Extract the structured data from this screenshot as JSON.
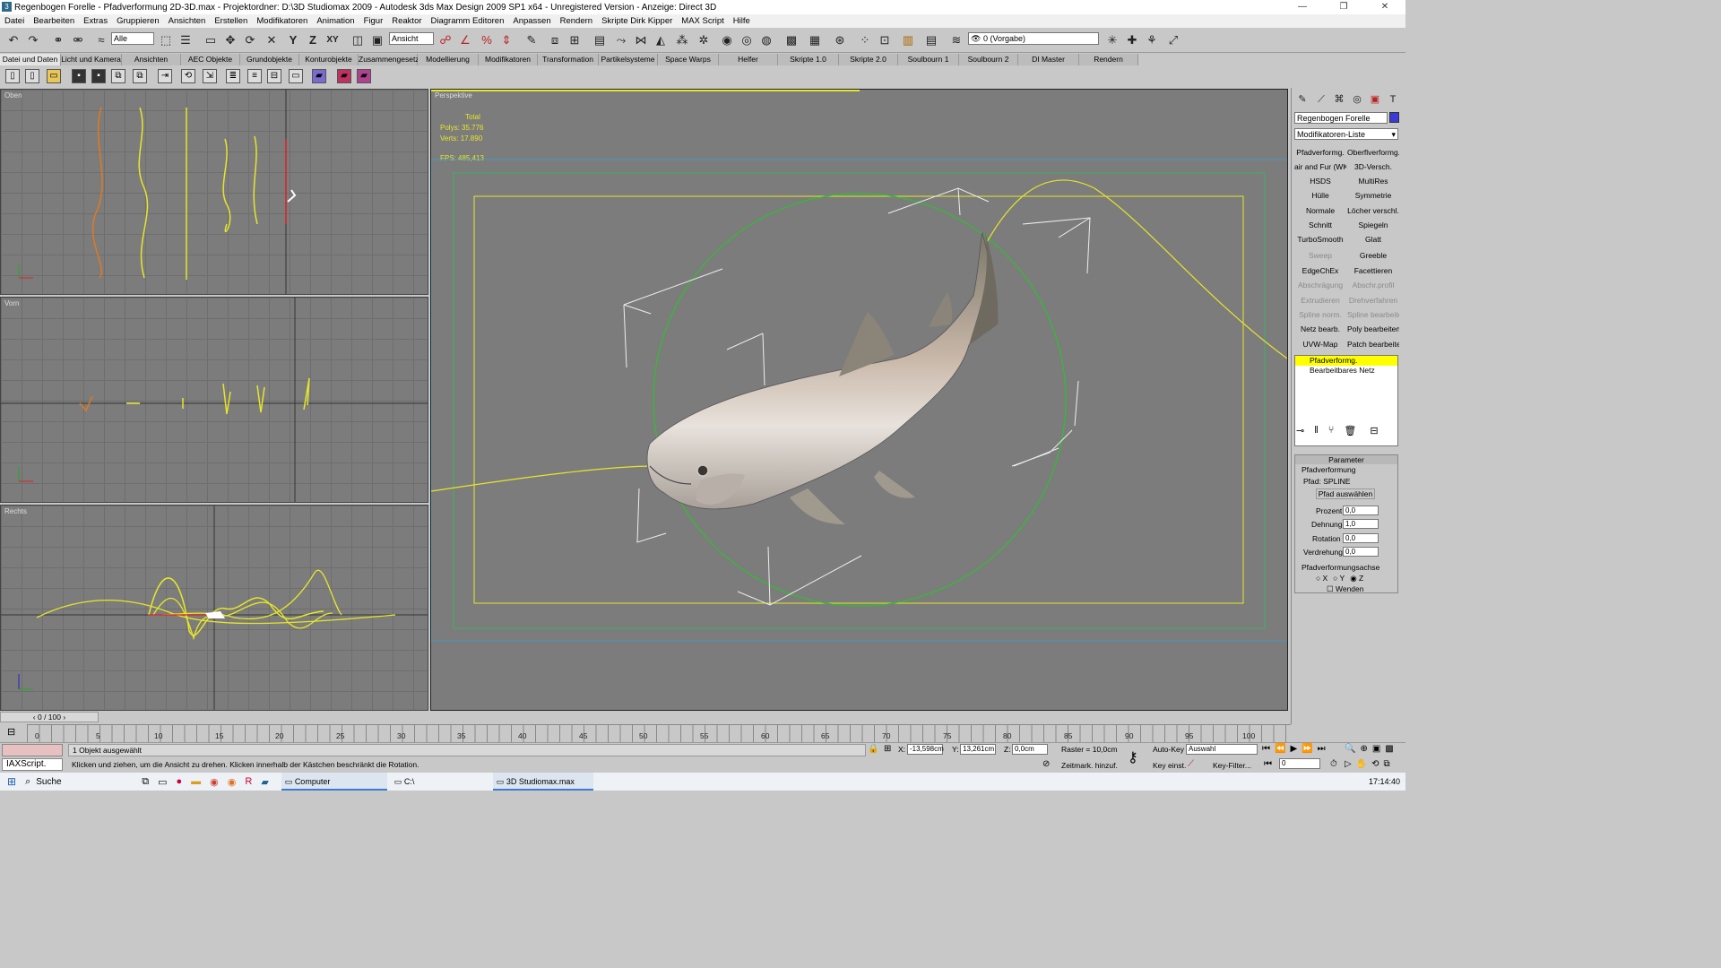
{
  "window": {
    "title": "Regenbogen Forelle - Pfadverformung 2D-3D.max    -  Projektordner: D:\\3D Studiomax 2009    -   Autodesk 3ds Max Design 2009 SP1  x64  - Unregistered Version    - Anzeige: Direct 3D",
    "app_icon": "3ds-max-icon",
    "controls": [
      "—",
      "❐",
      "✕"
    ]
  },
  "menu": [
    "Datei",
    "Bearbeiten",
    "Extras",
    "Gruppieren",
    "Ansichten",
    "Erstellen",
    "Modifikatoren",
    "Animation",
    "Figur",
    "Reaktor",
    "Diagramm Editoren",
    "Anpassen",
    "Rendern",
    "Skripte Dirk Kipper",
    "MAX Script",
    "Hilfe"
  ],
  "toolbar": {
    "selection_filter": "Alle",
    "coord_system": "Ansicht",
    "layer": "0 (Vorgabe)"
  },
  "tabs": [
    "Datei und Daten",
    "Licht und Kamera",
    "Ansichten",
    "AEC Objekte",
    "Grundobjekte",
    "Konturobjekte",
    "Zusammengesetzt",
    "Modellierung",
    "Modifikatoren",
    "Transformation",
    "Partikelsysteme",
    "Space Warps",
    "Helfer",
    "Skripte 1.0",
    "Skripte 2.0",
    "Soulbourn 1",
    "Soulbourn 2",
    "DI Master",
    "Rendern"
  ],
  "viewports": {
    "top": "Oben",
    "front": "Vorn",
    "right": "Rechts",
    "persp": "Perspektive",
    "stats": {
      "total_label": "Total",
      "polys_label": "Polys:",
      "polys": "35.776",
      "verts_label": "Verts:",
      "verts": "17.890",
      "fps_label": "FPS:",
      "fps": "485,413"
    }
  },
  "panel": {
    "object_name": "Regenbogen Forelle",
    "object_color": "#3a3ad8",
    "modifier_list": "Modifikatoren-Liste",
    "buttons": [
      [
        "Pfadverformg.",
        "Oberflverformg."
      ],
      [
        "air and Fur (WKN",
        "3D-Versch."
      ],
      [
        "HSDS",
        "MultiRes"
      ],
      [
        "Hülle",
        "Symmetrie"
      ],
      [
        "Normale",
        "Löcher verschl."
      ],
      [
        "Schnitt",
        "Spiegeln"
      ],
      [
        "TurboSmooth",
        "Glatt"
      ],
      [
        "Sweep",
        "Greeble"
      ],
      [
        "EdgeChEx",
        "Facettieren"
      ],
      [
        "Abschrägung",
        "Abschr.profil"
      ],
      [
        "Extrudieren",
        "Drehverfahren"
      ],
      [
        "Spline norm.",
        "Spline bearbeiten"
      ],
      [
        "Netz bearb.",
        "Poly bearbeiten"
      ],
      [
        "UVW-Map",
        "Patch bearbeiten"
      ]
    ],
    "disabled": [
      "Sweep",
      "Abschrägung",
      "Abschr.profil",
      "Extrudieren",
      "Drehverfahren",
      "Spline norm.",
      "Spline bearbeiten"
    ],
    "stack": [
      "Pfadverformg.",
      "Bearbeitbares Netz"
    ],
    "rollout_title": "Parameter",
    "group_title": "Pfadverformung",
    "path_label": "Pfad:",
    "path_value": "SPLINE",
    "pick_button": "Pfad auswählen",
    "spinners": [
      {
        "label": "Prozent",
        "value": "0,0"
      },
      {
        "label": "Dehnung",
        "value": "1,0"
      },
      {
        "label": "Rotation",
        "value": "0,0"
      },
      {
        "label": "Verdrehung",
        "value": "0,0"
      }
    ],
    "axis_group": "Pfadverformungsachse",
    "axes": [
      "X",
      "Y",
      "Z"
    ],
    "axis_selected": "Z",
    "flip_label": "Wenden"
  },
  "timeline": {
    "frame": "0 / 100",
    "ticks": [
      "0",
      "5",
      "10",
      "15",
      "20",
      "25",
      "30",
      "35",
      "40",
      "45",
      "50",
      "55",
      "60",
      "65",
      "70",
      "75",
      "80",
      "85",
      "90",
      "95",
      "100"
    ]
  },
  "status": {
    "script_label": "IAXScript.",
    "selected": "1 Objekt ausgewählt",
    "prompt": "Klicken und ziehen, um die Ansicht zu drehen. Klicken innerhalb der Kästchen beschränkt die Rotation.",
    "x_label": "X:",
    "x": "-13,598cm",
    "y_label": "Y:",
    "y": "13,261cm",
    "z_label": "Z:",
    "z": "0,0cm",
    "grid": "Raster = 10,0cm",
    "autokey": "Auto-Key",
    "autokey_mode": "Auswahl",
    "setkey": "Key einst.",
    "keyfilter": "Key-Filter...",
    "timetag": "Zeitmark. hinzuf.",
    "frame_field": "0"
  },
  "taskbar": {
    "search": "Suche",
    "items": [
      "Computer",
      "C:\\",
      "3D Studiomax.max"
    ],
    "time": "17:14:40"
  },
  "colors": {
    "viewport": "#7c7c7c",
    "spline": "#e6e62a",
    "trajectory": "#2fbf2f"
  }
}
